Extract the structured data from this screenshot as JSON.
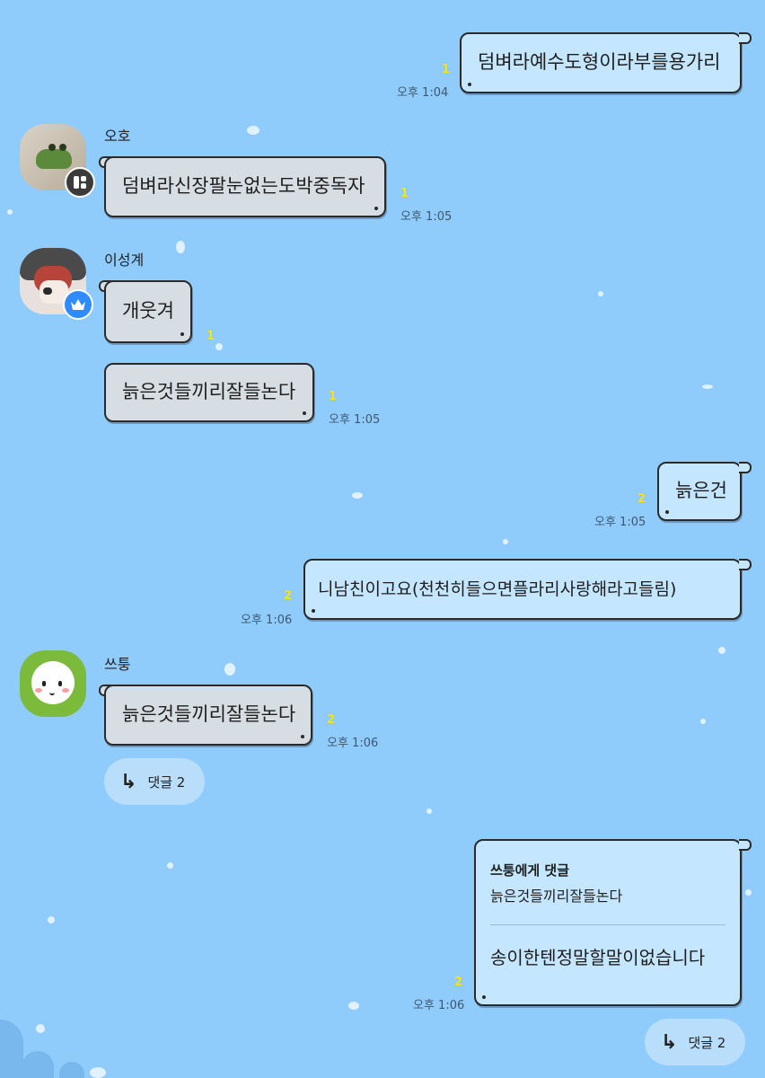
{
  "messages": [
    {
      "id": "m1",
      "side": "me",
      "text": "덤벼라예수도형이라부를용가리",
      "count": "1",
      "time": "오후 1:04"
    },
    {
      "id": "m2",
      "side": "other",
      "sender": "오호",
      "text": "덤벼라신장팔눈없는도박중독자",
      "count": "1",
      "time": "오후 1:05"
    },
    {
      "id": "m3",
      "side": "other",
      "sender": "이성계",
      "text": "개웃겨",
      "count": "1",
      "time": ""
    },
    {
      "id": "m4",
      "side": "other",
      "text": "늙은것들끼리잘들논다",
      "count": "1",
      "time": "오후 1:05"
    },
    {
      "id": "m5",
      "side": "me",
      "text": "늙은건",
      "count": "2",
      "time": "오후 1:05"
    },
    {
      "id": "m6",
      "side": "me",
      "text": "니남친이고요(천천히들으면플라리사랑해라고들림)",
      "count": "2",
      "time": "오후 1:06"
    },
    {
      "id": "m7",
      "side": "other",
      "sender": "쓰퉁",
      "text": "늙은것들끼리잘들논다",
      "count": "2",
      "time": "오후 1:06"
    },
    {
      "id": "m8",
      "side": "me",
      "reply_to": "쓰퉁에게 댓글",
      "quoted": "늙은것들끼리잘들논다",
      "text": "송이한텐정말할말이없습니다",
      "count": "2",
      "time": "오후 1:06"
    }
  ],
  "reply_buttons": [
    {
      "label": "댓글 2"
    },
    {
      "label": "댓글 2"
    }
  ],
  "icons": {
    "reply_arrow": "reply-arrow-icon",
    "crown": "crown-icon",
    "grid": "grid-icon"
  },
  "colors": {
    "background": "#8fcbfb",
    "my_bubble": "#c4e6ff",
    "other_bubble": "#d6dde3",
    "unread_count": "#ffe600"
  }
}
